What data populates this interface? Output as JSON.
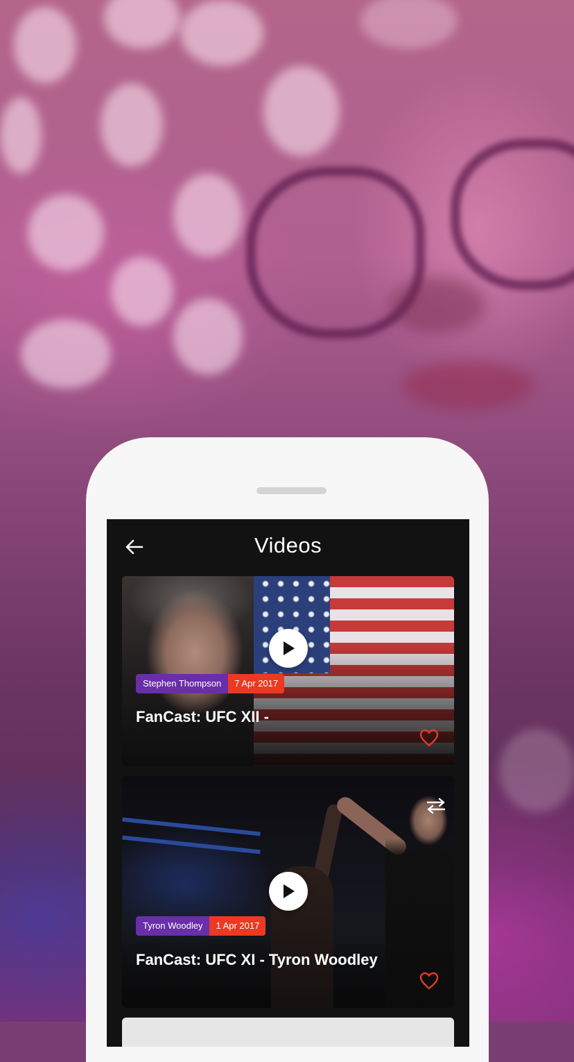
{
  "header": {
    "title": "Videos",
    "back_icon": "arrow-left-icon"
  },
  "videos": [
    {
      "athlete": "Stephen Thompson",
      "date": "7 Apr 2017",
      "title": "FanCast: UFC XII -",
      "favorited": false
    },
    {
      "athlete": "Tyron Woodley",
      "date": "1 Apr 2017",
      "title": "FanCast: UFC XI - Tyron Woodley",
      "favorited": false
    }
  ],
  "colors": {
    "athlete_tag": "#6a2ea8",
    "date_tag": "#ec3a22",
    "heart": "#e0392b",
    "screen_bg": "#121212"
  }
}
